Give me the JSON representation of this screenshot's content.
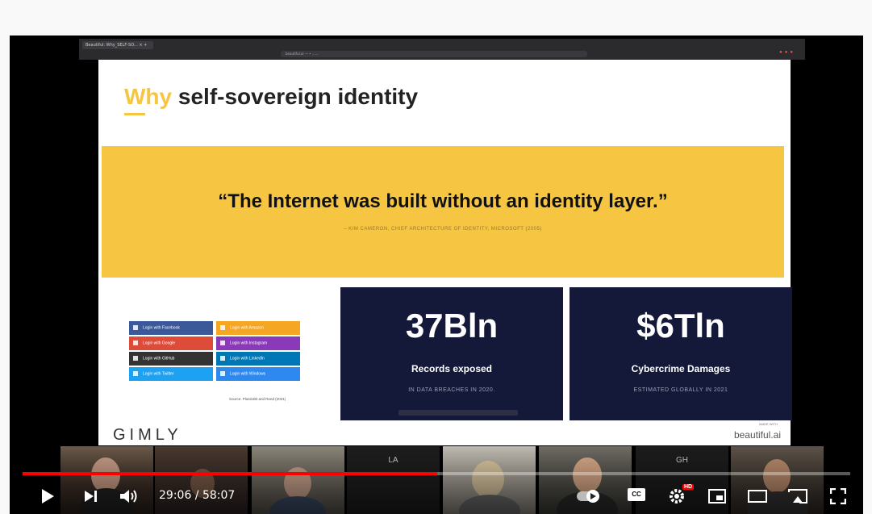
{
  "browser": {
    "tab_title": "Beautiful: Why_SELF-SO... × +",
    "address": "beautiful.ai — • ......"
  },
  "slide": {
    "title_accent": "Why",
    "title_rest": " self-sovereign identity",
    "quote": "“The Internet was built without an identity layer.”",
    "quote_source": "– KIM CAMERON, CHIEF ARCHITECTURE OF IDENTITY, MICROSOFT (2005)",
    "logins": [
      {
        "label": "Login with Facebook",
        "color": "#3b5998"
      },
      {
        "label": "Login with Amazon",
        "color": "#f5a623"
      },
      {
        "label": "Login with Google",
        "color": "#dd4b39"
      },
      {
        "label": "Login with Instagram",
        "color": "#8a3ab9"
      },
      {
        "label": "Login with GitHub",
        "color": "#333333"
      },
      {
        "label": "Login with LinkedIn",
        "color": "#0077b5"
      },
      {
        "label": "Login with Twitter",
        "color": "#1da1f2"
      },
      {
        "label": "Login with Windows",
        "color": "#2d89ef"
      }
    ],
    "login_source": "Source: PlasticBit and Reed (2021)",
    "stats": [
      {
        "big": "37Bln",
        "label": "Records exposed",
        "sub": "IN DATA BREACHES IN 2020."
      },
      {
        "big": "$6Tln",
        "label": "Cybercrime Damages",
        "sub": "ESTIMATED GLOBALLY IN 2021"
      }
    ],
    "brand": "GIMLY",
    "made_with": "MADE WITH",
    "made_with_brand": "beautiful.ai"
  },
  "participants": [
    {
      "initials": ""
    },
    {
      "initials": ""
    },
    {
      "initials": ""
    },
    {
      "initials": "LA"
    },
    {
      "initials": ""
    },
    {
      "initials": ""
    },
    {
      "initials": "GH"
    },
    {
      "initials": ""
    }
  ],
  "player": {
    "current_time": "29:06",
    "duration": "58:07",
    "time_display": "29:06 / 58:07",
    "progress_fraction": 0.501,
    "hd_badge": "HD",
    "cc_label": "CC",
    "icons": [
      "play-icon",
      "next-icon",
      "volume-icon",
      "autoplay-toggle",
      "captions-icon",
      "settings-icon",
      "miniplayer-icon",
      "theater-icon",
      "cast-icon",
      "fullscreen-icon"
    ],
    "accent_color": "#ff0000"
  }
}
